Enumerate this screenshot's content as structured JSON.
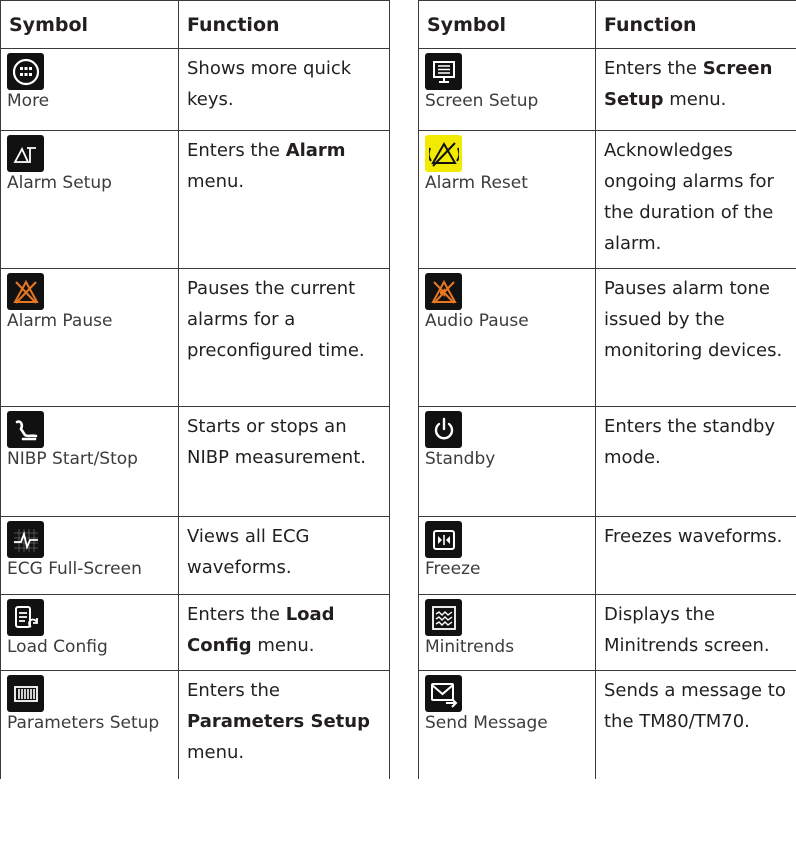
{
  "headers": {
    "symbol": "Symbol",
    "function": "Function"
  },
  "left_rows": [
    {
      "icon": "more-icon",
      "label": "More",
      "pre": "Shows more quick keys.",
      "bold": "",
      "post": ""
    },
    {
      "icon": "alarm-setup-icon",
      "label": "Alarm Setup",
      "pre": "Enters the ",
      "bold": "Alarm",
      "post": " menu."
    },
    {
      "icon": "alarm-pause-icon",
      "label": "Alarm Pause",
      "pre": "Pauses the current alarms for a preconfigured time.",
      "bold": "",
      "post": ""
    },
    {
      "icon": "nibp-icon",
      "label": "NIBP Start/Stop",
      "pre": "Starts or stops an NIBP measurement.",
      "bold": "",
      "post": ""
    },
    {
      "icon": "ecg-full-screen-icon",
      "label": "ECG Full-Screen",
      "pre": "Views all ECG waveforms.",
      "bold": "",
      "post": ""
    },
    {
      "icon": "load-config-icon",
      "label": "Load Config",
      "pre": "Enters the ",
      "bold": "Load Config",
      "post": " menu."
    },
    {
      "icon": "parameters-setup-icon",
      "label": "Parameters Setup",
      "pre": "Enters the ",
      "bold": "Parameters Setup",
      "post": " menu."
    }
  ],
  "right_rows": [
    {
      "icon": "screen-setup-icon",
      "label": "Screen Setup",
      "pre": "Enters the ",
      "bold": "Screen Setup",
      "post": " menu."
    },
    {
      "icon": "alarm-reset-icon",
      "label": "Alarm Reset",
      "pre": "Acknowledges ongoing alarms for the duration of the alarm.",
      "bold": "",
      "post": ""
    },
    {
      "icon": "audio-pause-icon",
      "label": "Audio Pause",
      "pre": "Pauses alarm tone issued by the monitoring devices.",
      "bold": "",
      "post": ""
    },
    {
      "icon": "standby-icon",
      "label": "Standby",
      "pre": "Enters the standby mode.",
      "bold": "",
      "post": ""
    },
    {
      "icon": "freeze-icon",
      "label": "Freeze",
      "pre": "Freezes waveforms.",
      "bold": "",
      "post": ""
    },
    {
      "icon": "minitrends-icon",
      "label": "Minitrends",
      "pre": "Displays the Minitrends screen.",
      "bold": "",
      "post": ""
    },
    {
      "icon": "send-message-icon",
      "label": "Send Message",
      "pre": "Sends a message to the TM80/TM70.",
      "bold": "",
      "post": ""
    }
  ],
  "colors": {
    "icon_bg": "#111111",
    "alarm_orange": "#e87722",
    "reset_yellow": "#f2ea00"
  }
}
